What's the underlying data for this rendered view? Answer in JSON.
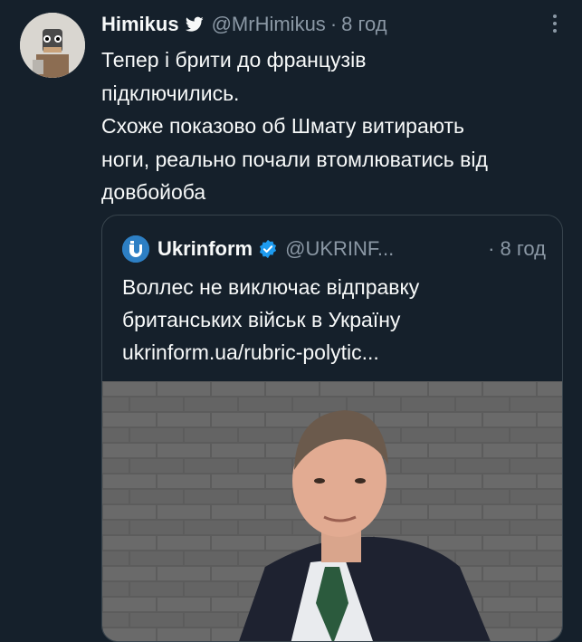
{
  "tweet": {
    "author_name": "Himikus",
    "author_handle": "@MrHimikus",
    "separator": "·",
    "time": "8 год",
    "lines": [
      "Тепер і брити до французів",
      "підключились.",
      "Схоже показово об Шмату витирають",
      "ноги, реально почали втомлюватись від",
      "довбойоба"
    ]
  },
  "quote": {
    "author_name": "Ukrinform",
    "author_handle": "@UKRINF...",
    "time": "· 8 год",
    "lines": [
      "Воллес не виключає відправку",
      "британських військ в Україну",
      "ukrinform.ua/rubric-polytic..."
    ]
  },
  "colors": {
    "background": "#15202b",
    "text": "#f7f9f9",
    "secondary": "#8b98a5",
    "border": "#38444d",
    "verified": "#1d9bf0"
  },
  "icons": [
    "twitter-bird-icon",
    "more-options-icon",
    "verified-badge-icon",
    "ukrinform-logo-icon"
  ]
}
